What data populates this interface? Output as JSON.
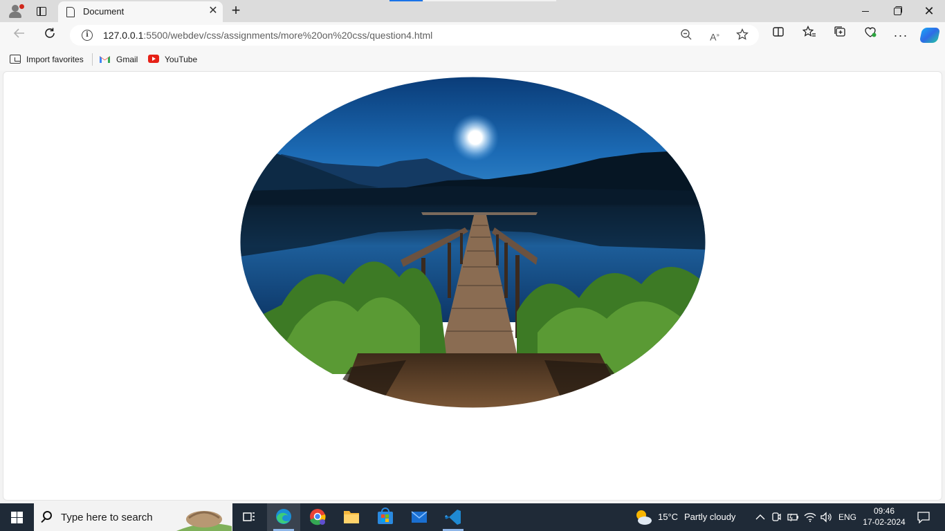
{
  "browser": {
    "tab": {
      "title": "Document"
    },
    "address": {
      "host": "127.0.0.1",
      "path": ":5500/webdev/css/assignments/more%20on%20css/question4.html"
    },
    "favorites": [
      {
        "label": "Import favorites"
      },
      {
        "label": "Gmail"
      },
      {
        "label": "YouTube"
      }
    ],
    "colors": {
      "accent": "#1a73e8",
      "chrome": "#dcdcdc",
      "toolbar": "#f7f7f7"
    }
  },
  "page": {
    "image": {
      "subject": "moonlit lake with wooden pier",
      "shape": "ellipse"
    }
  },
  "taskbar": {
    "search_placeholder": "Type here to search",
    "weather": {
      "temp": "15°C",
      "condition": "Partly cloudy"
    },
    "language": "ENG",
    "time": "09:46",
    "date": "17-02-2024",
    "apps": [
      "task-view",
      "edge",
      "chrome",
      "file-explorer",
      "microsoft-store",
      "mail",
      "vscode"
    ]
  }
}
